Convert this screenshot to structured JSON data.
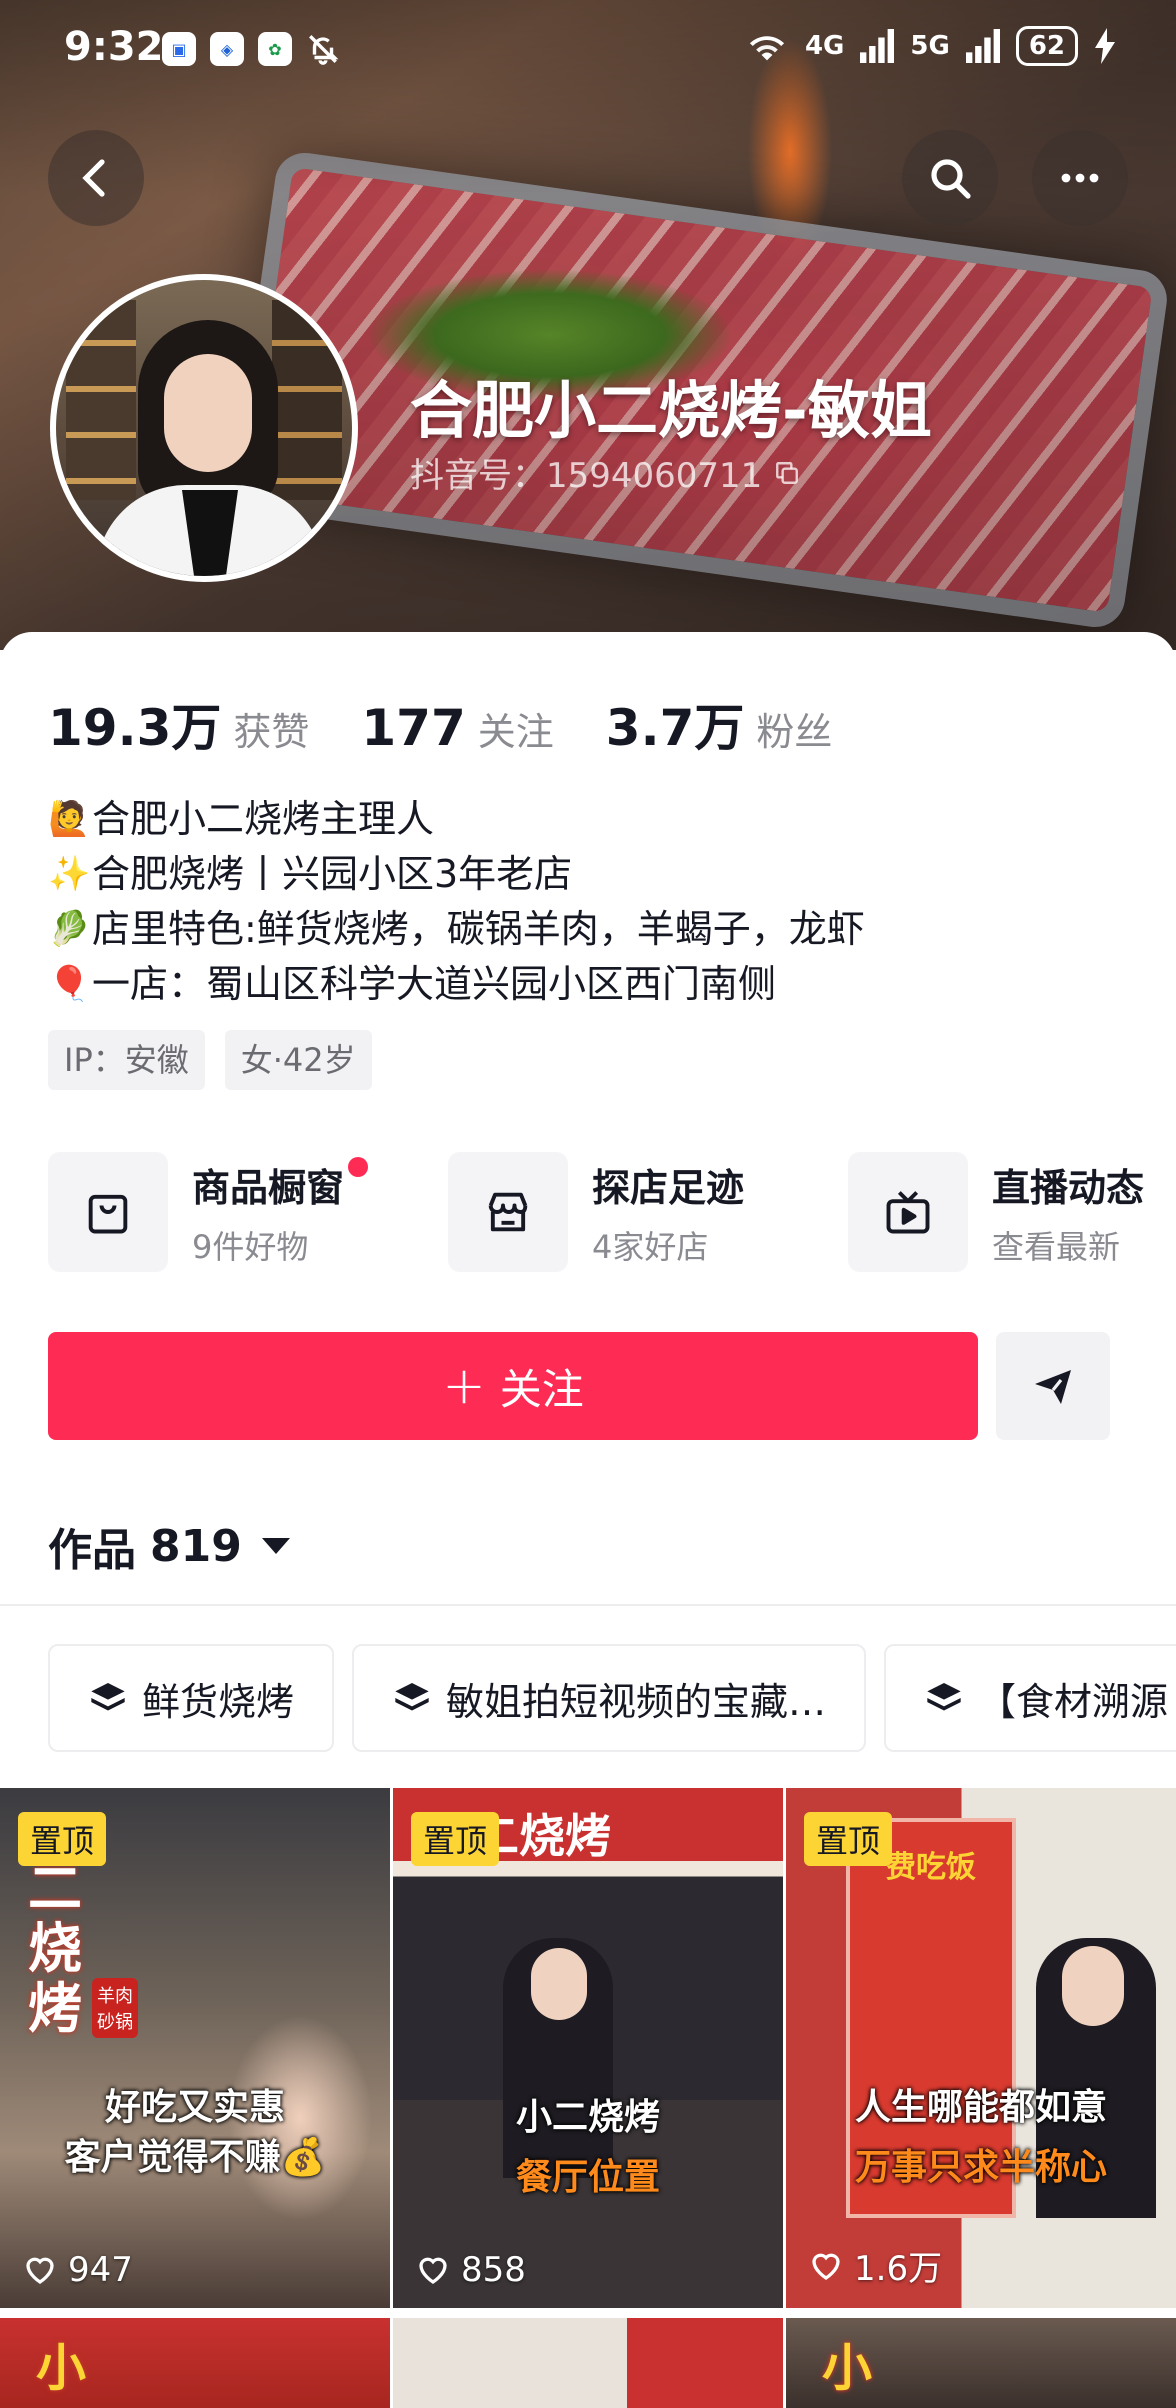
{
  "status_bar": {
    "time": "9:32",
    "network_1": "4G",
    "network_2": "5G",
    "battery": "62"
  },
  "header": {
    "name": "合肥小二烧烤-敏姐",
    "douyin_id": "抖音号：1594060711"
  },
  "stats": [
    {
      "value": "19.3万",
      "label": "获赞"
    },
    {
      "value": "177",
      "label": "关注"
    },
    {
      "value": "3.7万",
      "label": "粉丝"
    }
  ],
  "bio": [
    {
      "emoji": "🙋",
      "text": "合肥小二烧烤主理人"
    },
    {
      "emoji": "✨",
      "text": "合肥烧烤丨兴园小区3年老店"
    },
    {
      "emoji": "🥬",
      "text": "店里特色:鲜货烧烤，碳锅羊肉，羊蝎子，龙虾"
    },
    {
      "emoji": "🎈",
      "text": "一店：蜀山区科学大道兴园小区西门南侧"
    }
  ],
  "tags": [
    "IP：安徽",
    "女·42岁"
  ],
  "features": [
    {
      "title": "商品橱窗",
      "subtitle": "9件好物",
      "icon": "bag-icon"
    },
    {
      "title": "探店足迹",
      "subtitle": "4家好店",
      "icon": "store-icon"
    },
    {
      "title": "直播动态",
      "subtitle": "查看最新",
      "icon": "tv-icon"
    }
  ],
  "follow_label": "关注",
  "works": {
    "label": "作品",
    "count": "819"
  },
  "collections": [
    "鲜货烧烤",
    "敏姐拍短视频的宝藏…",
    "【食材溯源"
  ],
  "videos": [
    {
      "pin": "置顶",
      "line1": "好吃又实惠",
      "line2": "客户觉得不赚💰",
      "likes": "947",
      "side_title": "二烧烤",
      "sign": "羊肉砂锅"
    },
    {
      "pin": "置顶",
      "line1": "小二烧烤",
      "line2": "餐厅位置",
      "likes": "858",
      "sign": "二烧烤"
    },
    {
      "pin": "置顶",
      "line1": "人生哪能都如意",
      "line2": "万事只求半称心",
      "likes": "1.6万",
      "sign": "费吃饭"
    }
  ],
  "row2_chars": [
    "小",
    "小"
  ],
  "colors": {
    "accent": "#fe2c55",
    "pin": "#fcd535",
    "overlay_orange": "#ff8a1c"
  }
}
